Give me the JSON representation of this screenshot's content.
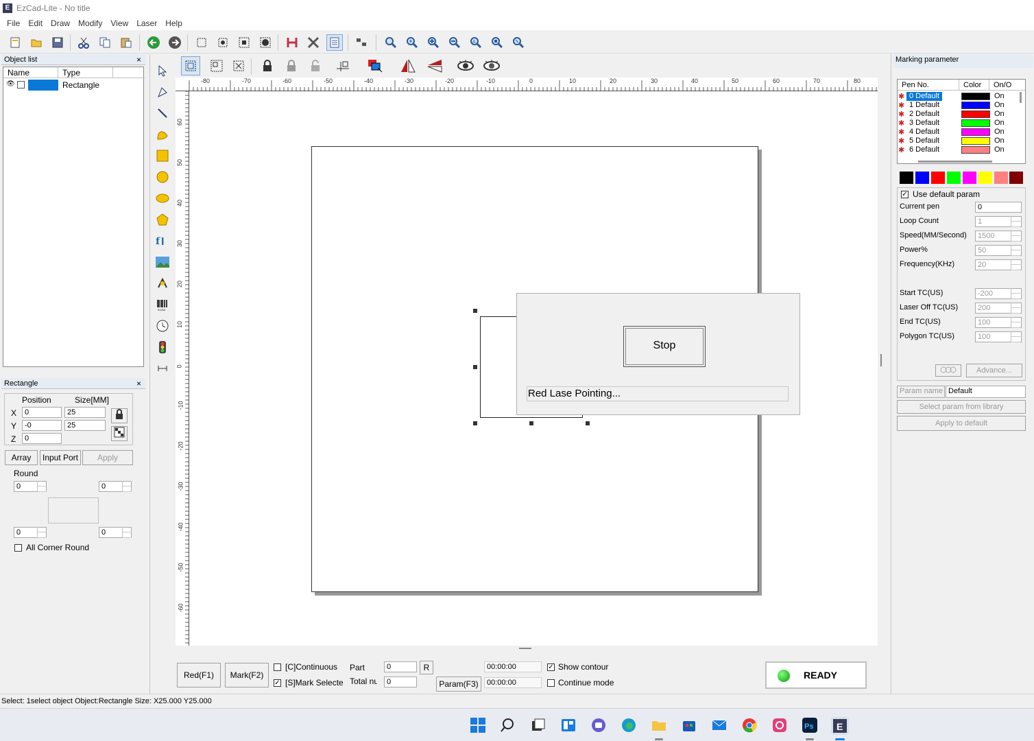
{
  "window": {
    "title": "EzCad-Lite - No title"
  },
  "menu": [
    "File",
    "Edit",
    "Draw",
    "Modify",
    "View",
    "Laser",
    "Help"
  ],
  "object_list": {
    "title": "Object list",
    "col_name": "Name",
    "col_type": "Type",
    "rows": [
      {
        "name": "",
        "type": "Rectangle"
      }
    ]
  },
  "props": {
    "title": "Rectangle",
    "position_label": "Position",
    "size_label": "Size[MM]",
    "x_label": "X",
    "y_label": "Y",
    "z_label": "Z",
    "x_pos": "0",
    "y_pos": "-0",
    "z_pos": "0",
    "x_size": "25",
    "y_size": "25",
    "array_btn": "Array",
    "input_port_btn": "Input Port",
    "apply_btn": "Apply",
    "round_label": "Round",
    "round_tl": "0",
    "round_tr": "0",
    "round_bl": "0",
    "round_br": "0",
    "all_corner": "All Corner Round"
  },
  "ruler": {
    "h_ticks": [
      "-80",
      "-70",
      "-60",
      "-50",
      "-40",
      "-30",
      "-20",
      "-10",
      "0",
      "10",
      "20",
      "30",
      "40",
      "50",
      "60",
      "70",
      "80"
    ],
    "v_ticks": [
      "60",
      "50",
      "40",
      "30",
      "20",
      "10",
      "0",
      "-10",
      "-20",
      "-30",
      "-40",
      "-50",
      "-60"
    ]
  },
  "dialog": {
    "stop_btn": "Stop",
    "status": "Red Lase Pointing..."
  },
  "bottom": {
    "red_btn": "Red(F1)",
    "mark_btn": "Mark(F2)",
    "continuous": "[C]Continuous",
    "mark_selected": "[S]Mark Selectec",
    "part_label": "Part",
    "part_value": "0",
    "total_label": "Total nu",
    "total_value": "0",
    "r_btn": "R",
    "param_btn": "Param(F3)",
    "time1": "00:00:00",
    "time2": "00:00:00",
    "show_contour": "Show contour",
    "continue_mode": "Continue mode",
    "ready": "READY"
  },
  "marking": {
    "title": "Marking parameter",
    "col_pen": "Pen No.",
    "col_color": "Color",
    "col_on": "On/O",
    "pens": [
      {
        "label": "0 Default",
        "color": "#000000",
        "on": "On"
      },
      {
        "label": "1 Default",
        "color": "#0000ff",
        "on": "On"
      },
      {
        "label": "2 Default",
        "color": "#ff0000",
        "on": "On"
      },
      {
        "label": "3 Default",
        "color": "#00ff00",
        "on": "On"
      },
      {
        "label": "4 Default",
        "color": "#ff00ff",
        "on": "On"
      },
      {
        "label": "5 Default",
        "color": "#ffff00",
        "on": "On"
      },
      {
        "label": "6 Default",
        "color": "#ff8080",
        "on": "On"
      }
    ],
    "palette": [
      "#000000",
      "#0000ff",
      "#ff0000",
      "#00ff00",
      "#ff00ff",
      "#ffff00",
      "#ff8080",
      "#800000"
    ],
    "use_default": "Use default param",
    "params": [
      {
        "label": "Current pen",
        "value": "0"
      },
      {
        "label": "Loop Count",
        "value": "1"
      },
      {
        "label": "Speed(MM/Second)",
        "value": "1500"
      },
      {
        "label": "Power%",
        "value": "50"
      },
      {
        "label": "Frequency(KHz)",
        "value": "20"
      },
      {
        "label": "Start TC(US)",
        "value": "-200"
      },
      {
        "label": "Laser Off TC(US)",
        "value": "200"
      },
      {
        "label": "End TC(US)",
        "value": "100"
      },
      {
        "label": "Polygon TC(US)",
        "value": "100"
      }
    ],
    "advance_btn": "Advance...",
    "param_name_label": "Param name",
    "param_name_value": "Default",
    "select_param_btn": "Select param from library",
    "apply_default_btn": "Apply to default"
  },
  "status_bar": "Select: 1select object Object:Rectangle Size: X25.000 Y25.000"
}
